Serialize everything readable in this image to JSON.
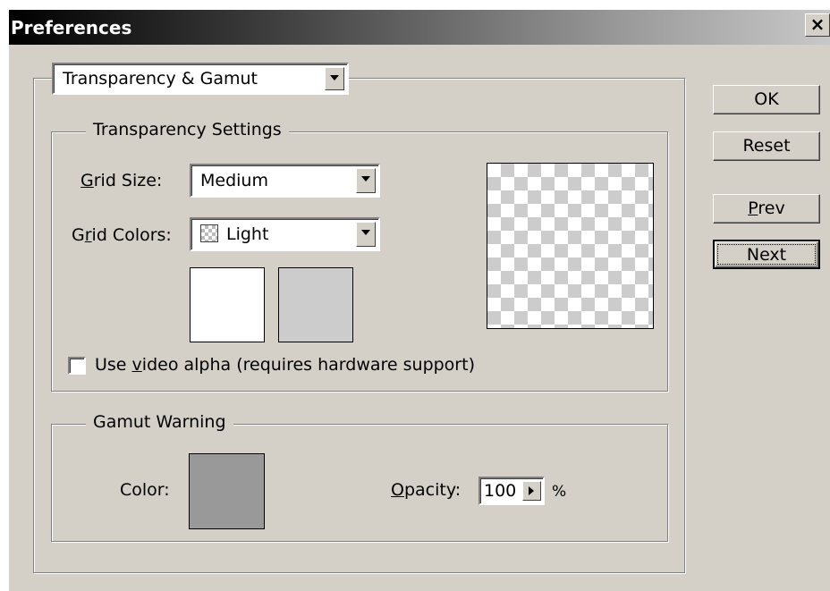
{
  "window": {
    "title": "Preferences"
  },
  "section": {
    "selected": "Transparency & Gamut"
  },
  "transparency": {
    "legend": "Transparency Settings",
    "grid_size_label": "Grid Size:",
    "grid_size_value": "Medium",
    "grid_colors_label": "Grid Colors:",
    "grid_colors_value": "Light",
    "swatch_colors": [
      "#ffffff",
      "#cccccc"
    ],
    "video_alpha_label": "Use video alpha (requires hardware support)",
    "video_alpha_checked": false
  },
  "gamut": {
    "legend": "Gamut Warning",
    "color_label": "Color:",
    "color_value": "#999999",
    "opacity_label": "Opacity:",
    "opacity_value": "100",
    "opacity_unit": "%"
  },
  "buttons": {
    "ok": "OK",
    "reset": "Reset",
    "prev": "Prev",
    "next": "Next"
  }
}
